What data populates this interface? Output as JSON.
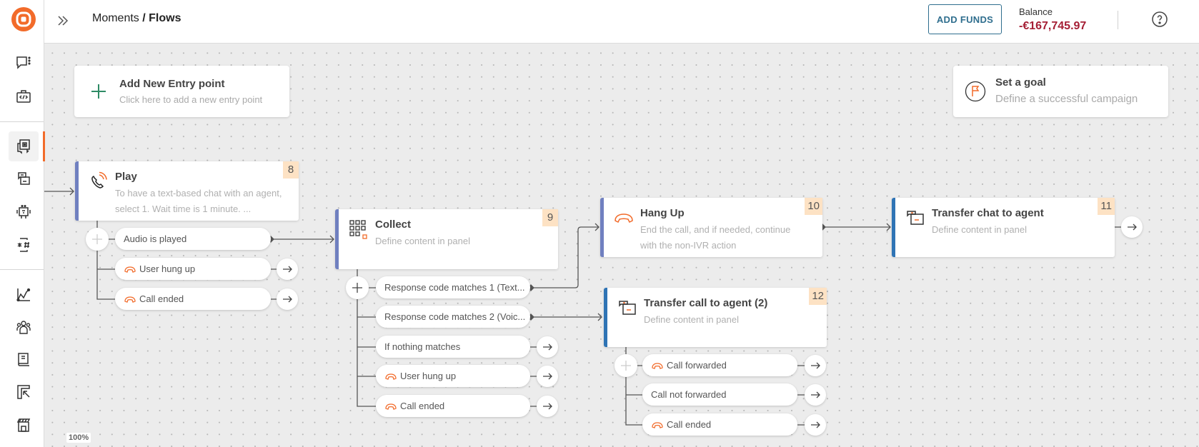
{
  "header": {
    "breadcrumb_parent": "Moments",
    "breadcrumb_sep": " / ",
    "breadcrumb_current": "Flows",
    "add_funds_label": "ADD FUNDS",
    "balance_label": "Balance",
    "balance_value": "-€167,745.97"
  },
  "sidebar": {
    "items": [
      {
        "name": "conversations",
        "icon": "chat-bubble-icon"
      },
      {
        "name": "developer",
        "icon": "code-briefcase-icon"
      },
      {
        "name": "moments-flows",
        "icon": "flows-icon",
        "active": true
      },
      {
        "name": "templates",
        "icon": "chat-templates-icon"
      },
      {
        "name": "bots",
        "icon": "robot-icon"
      },
      {
        "name": "ivr",
        "icon": "keypad-hash-icon"
      },
      {
        "name": "analytics",
        "icon": "chart-icon"
      },
      {
        "name": "people",
        "icon": "people-icon"
      },
      {
        "name": "docs",
        "icon": "book-icon"
      },
      {
        "name": "portal",
        "icon": "cursor-frame-icon"
      },
      {
        "name": "marketplace",
        "icon": "store-icon"
      }
    ]
  },
  "canvas": {
    "entry_card": {
      "title": "Add New Entry point",
      "subtitle": "Click here to add a new entry point"
    },
    "goal_card": {
      "title": "Set a goal",
      "subtitle": "Define a successful campaign"
    },
    "zoom_level": "100%",
    "nodes": {
      "play": {
        "number": "8",
        "title": "Play",
        "desc": "To have a text-based chat with an agent, select 1. Wait time is 1 minute. ...",
        "branches": [
          "Audio is played",
          "User hung up",
          "Call ended"
        ]
      },
      "collect": {
        "number": "9",
        "title": "Collect",
        "desc": "Define content in panel",
        "branches": [
          "Response code matches 1 (Text...",
          "Response code matches 2 (Voic...",
          "If nothing matches",
          "User hung up",
          "Call ended"
        ]
      },
      "hangup": {
        "number": "10",
        "title": "Hang Up",
        "desc": "End the call, and if needed, continue with the non-IVR action"
      },
      "transfer_chat": {
        "number": "11",
        "title": "Transfer chat to agent",
        "desc": "Define content in panel"
      },
      "transfer_call": {
        "number": "12",
        "title": "Transfer call to agent (2)",
        "desc": "Define content in panel",
        "branches": [
          "Call forwarded",
          "Call not forwarded",
          "Call ended"
        ]
      }
    }
  },
  "colors": {
    "accent": "#f26b2a",
    "balance_negative": "#a51f35",
    "node_bar_voice": "#7080c0",
    "node_bar_transfer": "#2f74b5",
    "node_badge": "#fde2c4"
  }
}
